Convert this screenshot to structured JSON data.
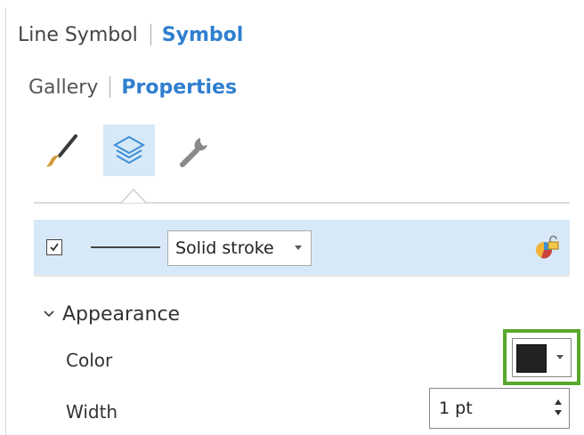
{
  "header": {
    "line_symbol_label": "Line Symbol",
    "symbol_label": "Symbol"
  },
  "subheader": {
    "gallery_label": "Gallery",
    "properties_label": "Properties"
  },
  "tabs": [
    {
      "icon": "paintbrush-icon",
      "active": false
    },
    {
      "icon": "layers-icon",
      "active": true
    },
    {
      "icon": "wrench-icon",
      "active": false
    }
  ],
  "layer": {
    "checked": true,
    "stroke_type": "Solid stroke",
    "lock_icon": "lock-icon"
  },
  "appearance": {
    "section_label": "Appearance",
    "color_label": "Color",
    "color_value": "#222222",
    "width_label": "Width",
    "width_value": "1 pt"
  },
  "colors": {
    "accent": "#2f7fcf",
    "active_tab_bg": "#d6e9f8",
    "highlight_outline": "#58a82a"
  }
}
